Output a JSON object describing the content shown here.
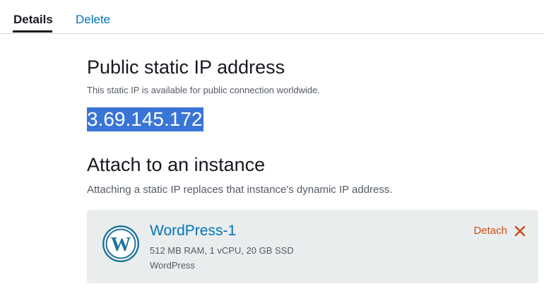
{
  "tabs": {
    "details": "Details",
    "delete": "Delete"
  },
  "static_ip": {
    "title": "Public static IP address",
    "description": "This static IP is available for public connection worldwide.",
    "address": "3.69.145.172"
  },
  "attach": {
    "title": "Attach to an instance",
    "description": "Attaching a static IP replaces that instance's dynamic IP address."
  },
  "instance": {
    "name": "WordPress-1",
    "specs": "512 MB RAM, 1 vCPU, 20 GB SSD",
    "blueprint": "WordPress",
    "icon": "wordpress-icon",
    "detach_label": "Detach",
    "detach_icon": "close-icon"
  },
  "colors": {
    "link": "#0073bb",
    "detach": "#c8511b",
    "selection": "#3875d7",
    "card_bg": "#eaeded",
    "wordpress": "#21759b"
  }
}
